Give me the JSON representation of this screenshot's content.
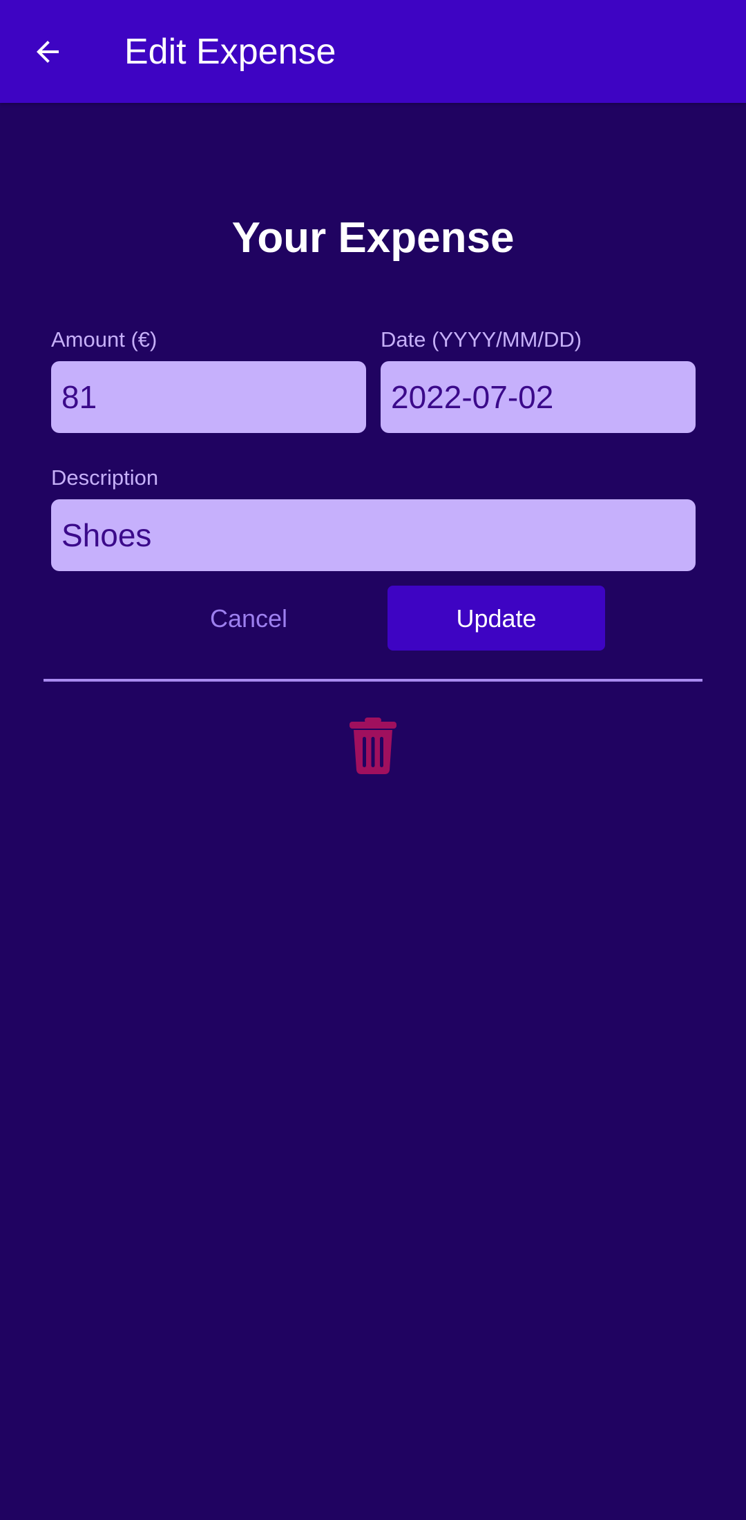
{
  "app_bar": {
    "title": "Edit Expense",
    "back_icon": "arrow-left-icon",
    "background": "#3e04c3"
  },
  "form": {
    "heading": "Your Expense",
    "amount": {
      "label": "Amount (€)",
      "value": "81"
    },
    "date": {
      "label": "Date (YYYY/MM/DD)",
      "value": "2022-07-02"
    },
    "description": {
      "label": "Description",
      "value": "Shoes"
    },
    "cancel_label": "Cancel",
    "update_label": "Update"
  },
  "delete": {
    "icon": "trash-icon",
    "color": "#a0105e"
  },
  "colors": {
    "background": "#200361",
    "primary": "#3e04c3",
    "input_fill": "#c6b0fc",
    "label": "#c6b0f8"
  }
}
